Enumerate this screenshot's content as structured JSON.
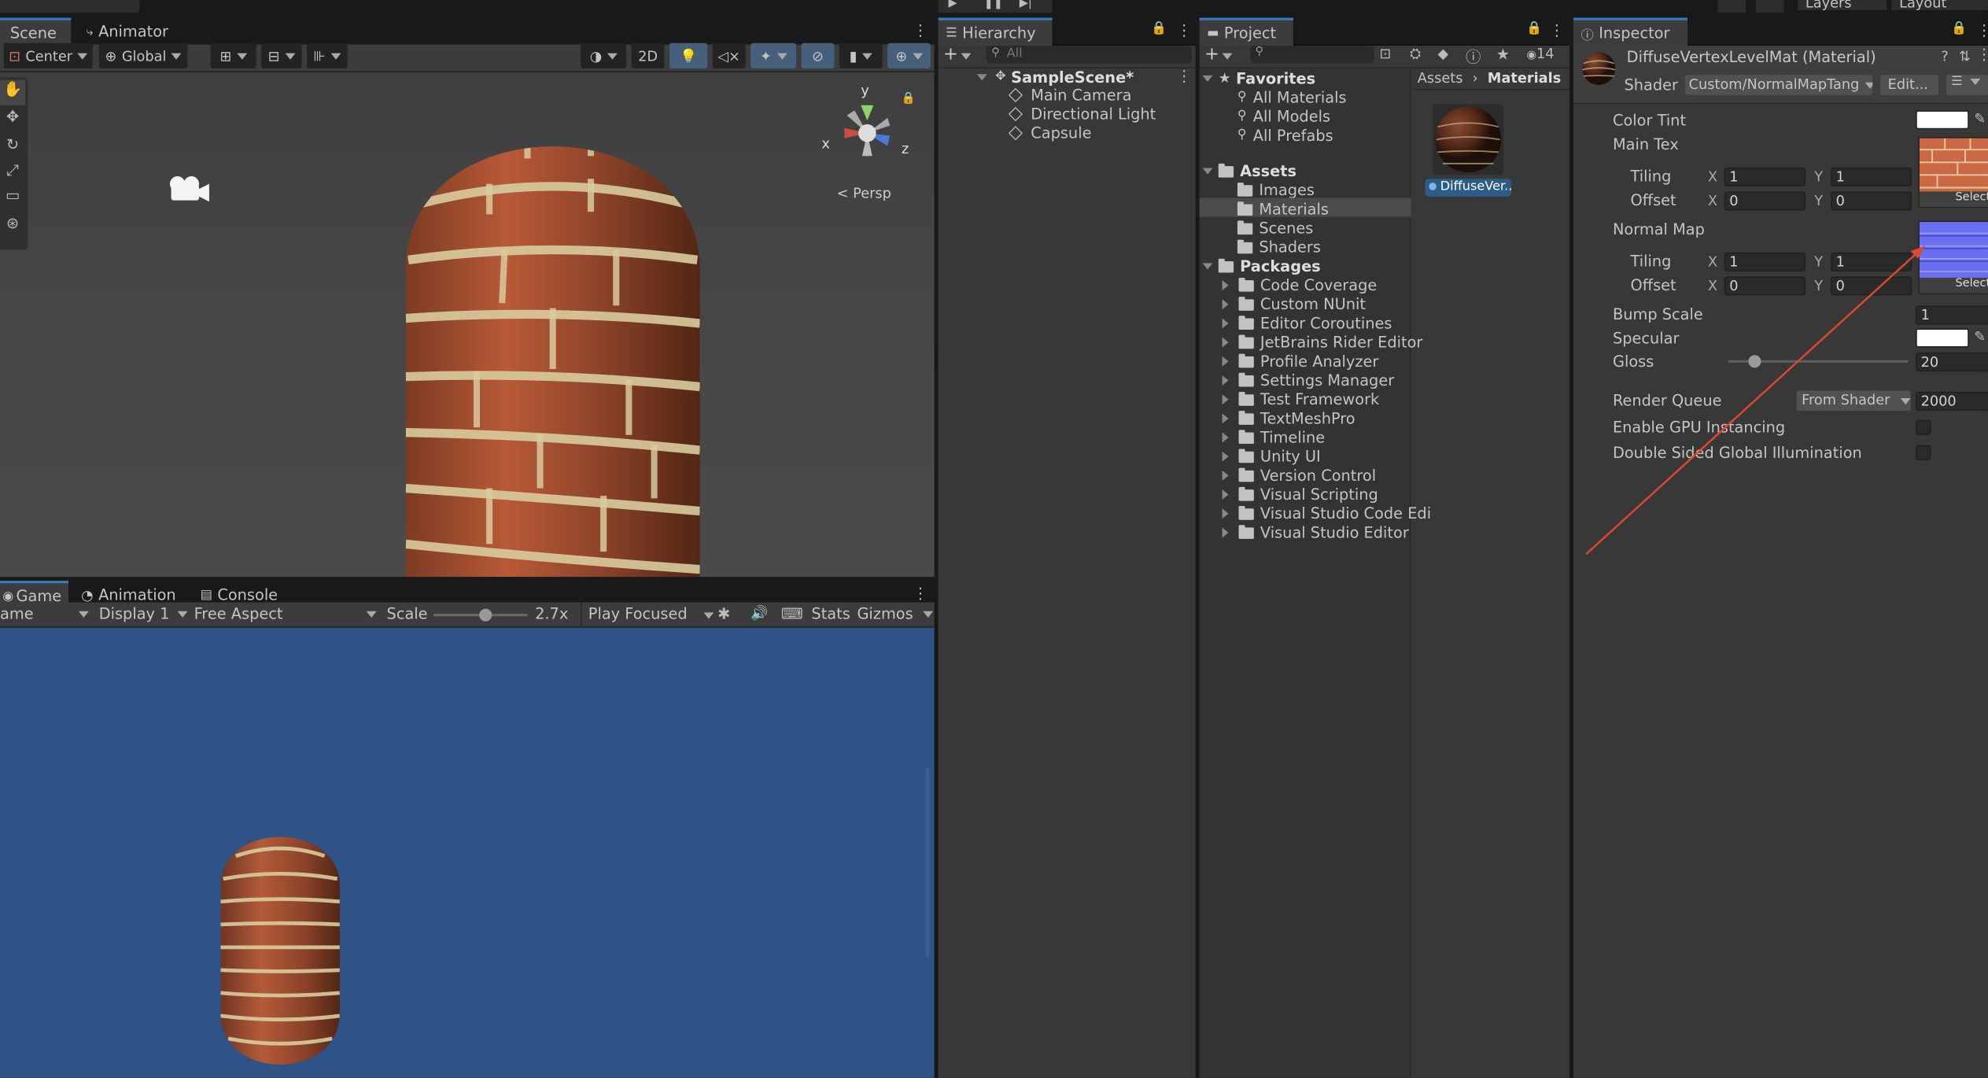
{
  "scene_tabs": {
    "scene": "Scene",
    "animator": "Animator"
  },
  "scene_toolbar": {
    "pivot": "Center",
    "space": "Global",
    "mode_2d": "2D",
    "persp": "Persp"
  },
  "gizmo": {
    "x": "x",
    "y": "y",
    "z": "z"
  },
  "game_tabs": {
    "game": "Game",
    "animation": "Animation",
    "console": "Console"
  },
  "game_toolbar": {
    "view": "ame",
    "display": "Display 1",
    "aspect": "Free Aspect",
    "scale_label": "Scale",
    "scale_value": "2.7x",
    "scale_fraction": 0.55,
    "play_mode": "Play Focused",
    "stats": "Stats",
    "gizmos": "Gizmos"
  },
  "hierarchy": {
    "title": "Hierarchy",
    "search_placeholder": "All",
    "scene": "SampleScene*",
    "items": [
      "Main Camera",
      "Directional Light",
      "Capsule"
    ]
  },
  "project": {
    "title": "Project",
    "hidden_count": "14",
    "favorites_label": "Favorites",
    "favorites": [
      "All Materials",
      "All Models",
      "All Prefabs"
    ],
    "assets_label": "Assets",
    "assets": [
      "Images",
      "Materials",
      "Scenes",
      "Shaders"
    ],
    "packages_label": "Packages",
    "packages": [
      "Code Coverage",
      "Custom NUnit",
      "Editor Coroutines",
      "JetBrains Rider Editor",
      "Profile Analyzer",
      "Settings Manager",
      "Test Framework",
      "TextMeshPro",
      "Timeline",
      "Unity UI",
      "Version Control",
      "Visual Scripting",
      "Visual Studio Code Edi",
      "Visual Studio Editor"
    ],
    "breadcrumb": [
      "Assets",
      "Materials"
    ],
    "asset_item": "DiffuseVer..."
  },
  "inspector": {
    "title": "Inspector",
    "material_name": "DiffuseVertexLevelMat (Material)",
    "shader_label": "Shader",
    "shader_value": "Custom/NormalMapTang",
    "edit_label": "Edit...",
    "color_tint": "Color Tint",
    "main_tex": "Main Tex",
    "tiling": "Tiling",
    "offset": "Offset",
    "x": "X",
    "y": "Y",
    "tiling_x": "1",
    "tiling_y": "1",
    "offset_x": "0",
    "offset_y": "0",
    "normal_map": "Normal Map",
    "nm_tiling_x": "1",
    "nm_tiling_y": "1",
    "nm_offset_x": "0",
    "nm_offset_y": "0",
    "select": "Select",
    "bump_scale": "Bump Scale",
    "bump_value": "1",
    "specular": "Specular",
    "gloss": "Gloss",
    "gloss_value": "20",
    "gloss_fraction": 0.15,
    "render_queue": "Render Queue",
    "render_queue_mode": "From Shader",
    "render_queue_value": "2000",
    "gpu_instancing": "Enable GPU Instancing",
    "double_sided": "Double Sided Global Illumination"
  },
  "top_toolbar": {
    "layers": "Layers",
    "layout": "Layout"
  },
  "colors": {
    "accent": "#3a79bb",
    "game_bg": "#2f5287",
    "annotation": "#e0482c",
    "panel": "#383838"
  }
}
